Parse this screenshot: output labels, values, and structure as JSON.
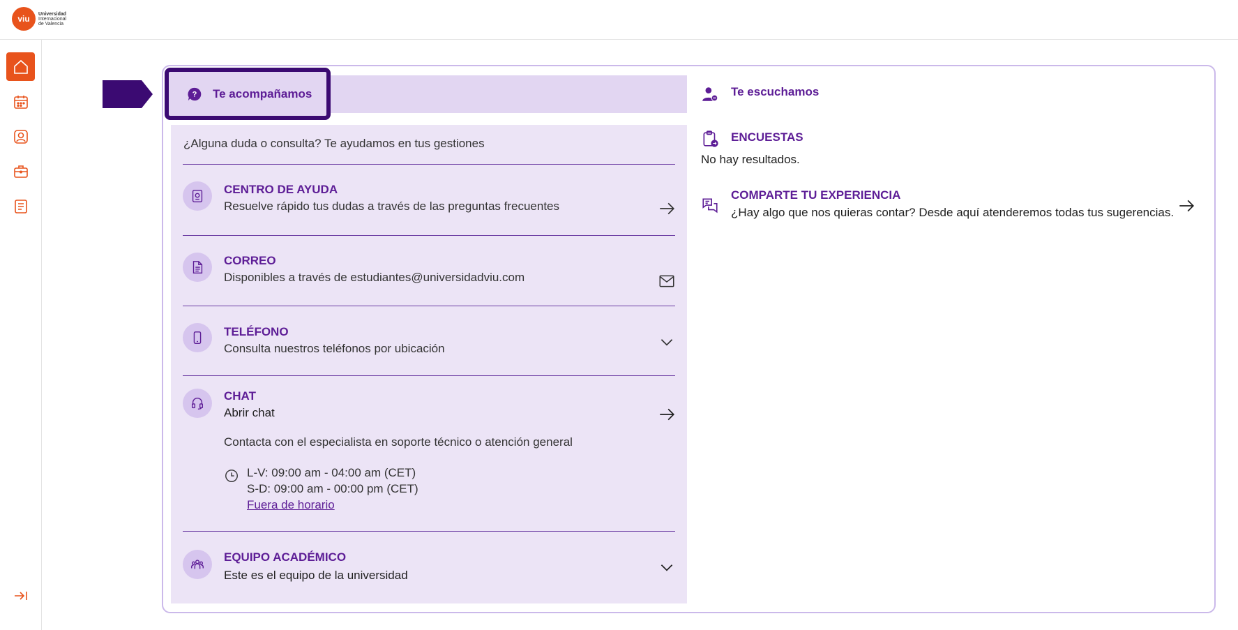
{
  "brand": {
    "logo_mark": "viu",
    "logo_line1": "Universidad",
    "logo_line2": "Internacional",
    "logo_line3": "de Valencia",
    "accent": "#e8531c",
    "purple": "#5d1d96"
  },
  "sidebar": {
    "items": [
      {
        "icon": "home-icon",
        "active": true
      },
      {
        "icon": "calendar-icon",
        "active": false
      },
      {
        "icon": "profile-icon",
        "active": false
      },
      {
        "icon": "briefcase-icon",
        "active": false
      },
      {
        "icon": "document-icon",
        "active": false
      }
    ],
    "collapse_icon": "collapse-arrow-icon"
  },
  "tab": {
    "label": "Te acompañamos",
    "icon": "question-bubble-icon"
  },
  "support": {
    "intro": "¿Alguna duda o consulta? Te ayudamos en tus gestiones",
    "items": [
      {
        "title": "CENTRO DE AYUDA",
        "subtitle": "Resuelve rápido tus dudas a través de las preguntas frecuentes",
        "icon": "help-center-icon",
        "action": "arrow-right-icon"
      },
      {
        "title": "CORREO",
        "subtitle": "Disponibles a través de estudiantes@universidadviu.com",
        "icon": "mail-document-icon",
        "action": "envelope-icon"
      },
      {
        "title": "TELÉFONO",
        "subtitle": "Consulta nuestros teléfonos por ubicación",
        "icon": "phone-icon",
        "action": "chevron-down-icon"
      },
      {
        "title": "CHAT",
        "subtitle": "Abrir chat",
        "icon": "headset-icon",
        "action": "arrow-right-icon"
      },
      {
        "title": "EQUIPO ACADÉMICO",
        "subtitle": "Este es el equipo de la universidad",
        "icon": "team-icon",
        "action": "chevron-down-icon"
      }
    ],
    "chat_description": "Contacta con el especialista en soporte técnico o atención general",
    "hours_weekdays": "L-V: 09:00 am - 04:00 am (CET)",
    "hours_weekend": "S-D: 09:00 am - 00:00 pm (CET)",
    "out_of_hours_link": "Fuera de horario"
  },
  "listen": {
    "title": "Te escuchamos",
    "surveys_title": "ENCUESTAS",
    "surveys_empty": "No hay resultados.",
    "share_title": "COMPARTE TU EXPERIENCIA",
    "share_text": "¿Hay algo que nos quieras contar? Desde aquí atenderemos todas tus sugerencias."
  }
}
